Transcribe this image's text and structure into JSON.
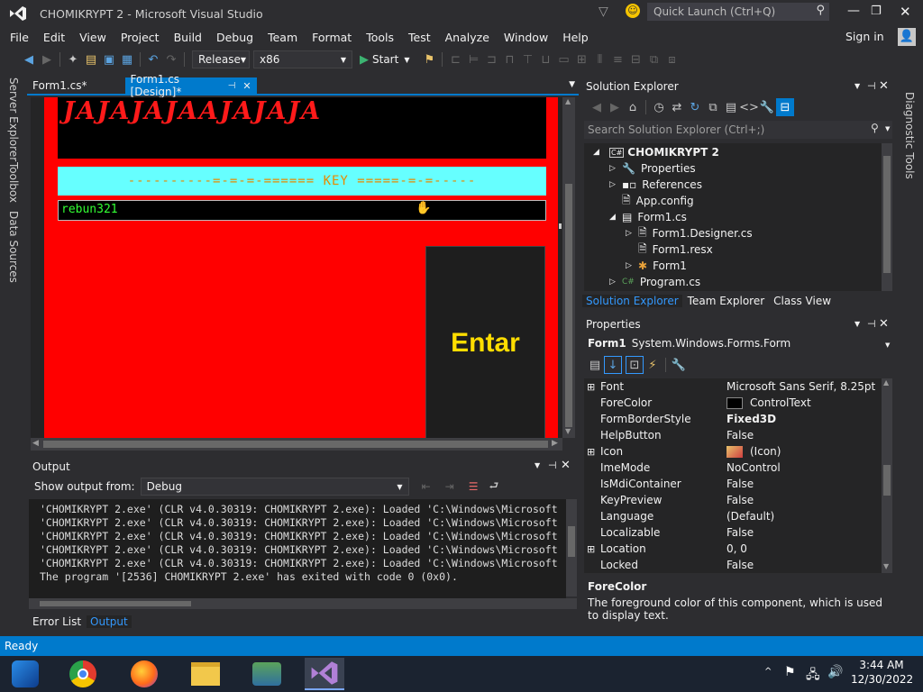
{
  "window": {
    "title": "CHOMIKRYPT 2 - Microsoft Visual Studio",
    "quick_launch_placeholder": "Quick Launch (Ctrl+Q)",
    "sign_in": "Sign in"
  },
  "menu": [
    "File",
    "Edit",
    "View",
    "Project",
    "Build",
    "Debug",
    "Team",
    "Format",
    "Tools",
    "Test",
    "Analyze",
    "Window",
    "Help"
  ],
  "toolbar": {
    "configuration": "Release",
    "platform": "x86",
    "start_label": "Start"
  },
  "editor_tabs": [
    {
      "label": "Form1.cs*"
    },
    {
      "label": "Form1.cs [Design]*"
    }
  ],
  "side_tabs_left": [
    "Server Explorer",
    "Toolbox",
    "Data Sources"
  ],
  "side_tabs_right": [
    "Diagnostic Tools"
  ],
  "designer": {
    "title_text": "JAJAJAJAAJAJAJA",
    "key_label": "----------=-=-=-====== KEY =====-=-=-----",
    "textbox_value": "rebun321",
    "button_label": "Entar"
  },
  "solution_explorer": {
    "title": "Solution Explorer",
    "search_placeholder": "Search Solution Explorer (Ctrl+;)",
    "items": [
      {
        "label": "CHOMIKRYPT 2",
        "level": 1
      },
      {
        "label": "Properties",
        "level": 2
      },
      {
        "label": "References",
        "level": 2
      },
      {
        "label": "App.config",
        "level": 2
      },
      {
        "label": "Form1.cs",
        "level": 2
      },
      {
        "label": "Form1.Designer.cs",
        "level": 3
      },
      {
        "label": "Form1.resx",
        "level": 3
      },
      {
        "label": "Form1",
        "level": 3
      },
      {
        "label": "Program.cs",
        "level": 2
      }
    ],
    "bottom_tabs": [
      "Solution Explorer",
      "Team Explorer",
      "Class View"
    ]
  },
  "properties": {
    "title": "Properties",
    "object": "Form1",
    "object_type": "System.Windows.Forms.Form",
    "rows": [
      {
        "name": "Font",
        "value": "Microsoft Sans Serif, 8.25pt",
        "expand": true
      },
      {
        "name": "ForeColor",
        "value": "ControlText",
        "expand": false
      },
      {
        "name": "FormBorderStyle",
        "value": "Fixed3D",
        "expand": false
      },
      {
        "name": "HelpButton",
        "value": "False",
        "expand": false
      },
      {
        "name": "Icon",
        "value": "(Icon)",
        "expand": true
      },
      {
        "name": "ImeMode",
        "value": "NoControl",
        "expand": false
      },
      {
        "name": "IsMdiContainer",
        "value": "False",
        "expand": false
      },
      {
        "name": "KeyPreview",
        "value": "False",
        "expand": false
      },
      {
        "name": "Language",
        "value": "(Default)",
        "expand": false
      },
      {
        "name": "Localizable",
        "value": "False",
        "expand": false
      },
      {
        "name": "Location",
        "value": "0, 0",
        "expand": true
      },
      {
        "name": "Locked",
        "value": "False",
        "expand": false
      }
    ],
    "desc_title": "ForeColor",
    "desc_text": "The foreground color of this component, which is used to display text."
  },
  "output": {
    "title": "Output",
    "show_from_label": "Show output from:",
    "source": "Debug",
    "lines": [
      "'CHOMIKRYPT 2.exe' (CLR v4.0.30319: CHOMIKRYPT 2.exe): Loaded 'C:\\Windows\\Microsoft",
      "'CHOMIKRYPT 2.exe' (CLR v4.0.30319: CHOMIKRYPT 2.exe): Loaded 'C:\\Windows\\Microsoft",
      "'CHOMIKRYPT 2.exe' (CLR v4.0.30319: CHOMIKRYPT 2.exe): Loaded 'C:\\Windows\\Microsoft",
      "'CHOMIKRYPT 2.exe' (CLR v4.0.30319: CHOMIKRYPT 2.exe): Loaded 'C:\\Windows\\Microsoft",
      "'CHOMIKRYPT 2.exe' (CLR v4.0.30319: CHOMIKRYPT 2.exe): Loaded 'C:\\Windows\\Microsoft",
      "The program '[2536] CHOMIKRYPT 2.exe' has exited with code 0 (0x0)."
    ],
    "bottom_tabs": [
      "Error List",
      "Output"
    ]
  },
  "status": {
    "text": "Ready"
  },
  "taskbar": {
    "time": "3:44 AM",
    "date": "12/30/2022"
  },
  "colors": {
    "accent": "#007acc",
    "form_red": "#ff0000",
    "key_cyan": "#66ffff",
    "button_gold": "#ffdd00"
  }
}
